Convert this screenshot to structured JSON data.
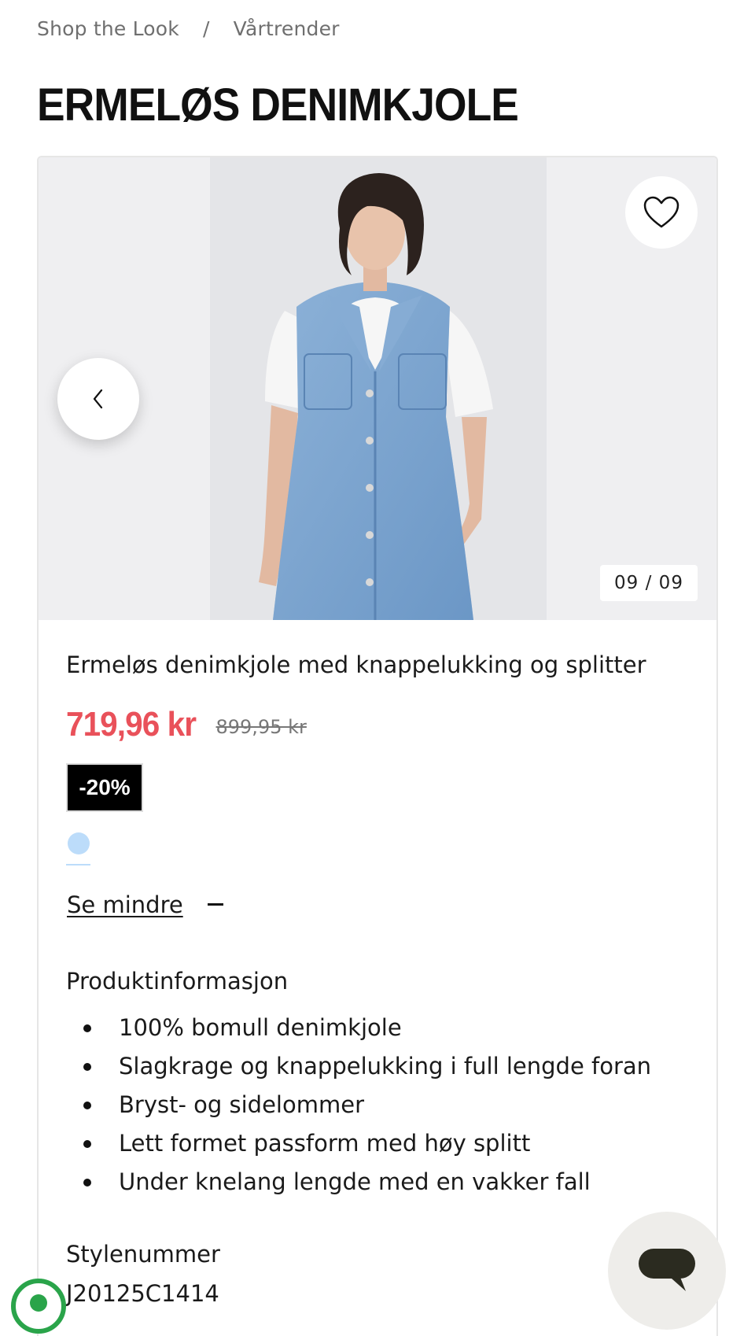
{
  "breadcrumb": {
    "item1": "Shop the Look",
    "separator": "/",
    "item2": "Vårtrender"
  },
  "page_title": "ERMELØS DENIMKJOLE",
  "gallery": {
    "counter": "09 / 09"
  },
  "product": {
    "name": "Ermeløs denimkjole med knappelukking og splitter",
    "price": "719,96 kr",
    "old_price": "899,95 kr",
    "discount": "-20%",
    "swatch_color": "#bcdcfa",
    "see_less": "Se mindre",
    "info_heading": "Produktinformasjon",
    "features": [
      "100% bomull denimkjole",
      "Slagkrage og knappelukking i full lengde foran",
      "Bryst- og sidelommer",
      "Lett formet passform med høy splitt",
      "Under knelang lengde med en vakker fall"
    ],
    "style_label": "Stylenummer",
    "style_number": "J20125C1414"
  },
  "colors": {
    "sale": "#e9515a",
    "badge_bg": "#000000",
    "eco": "#2aa44a"
  }
}
